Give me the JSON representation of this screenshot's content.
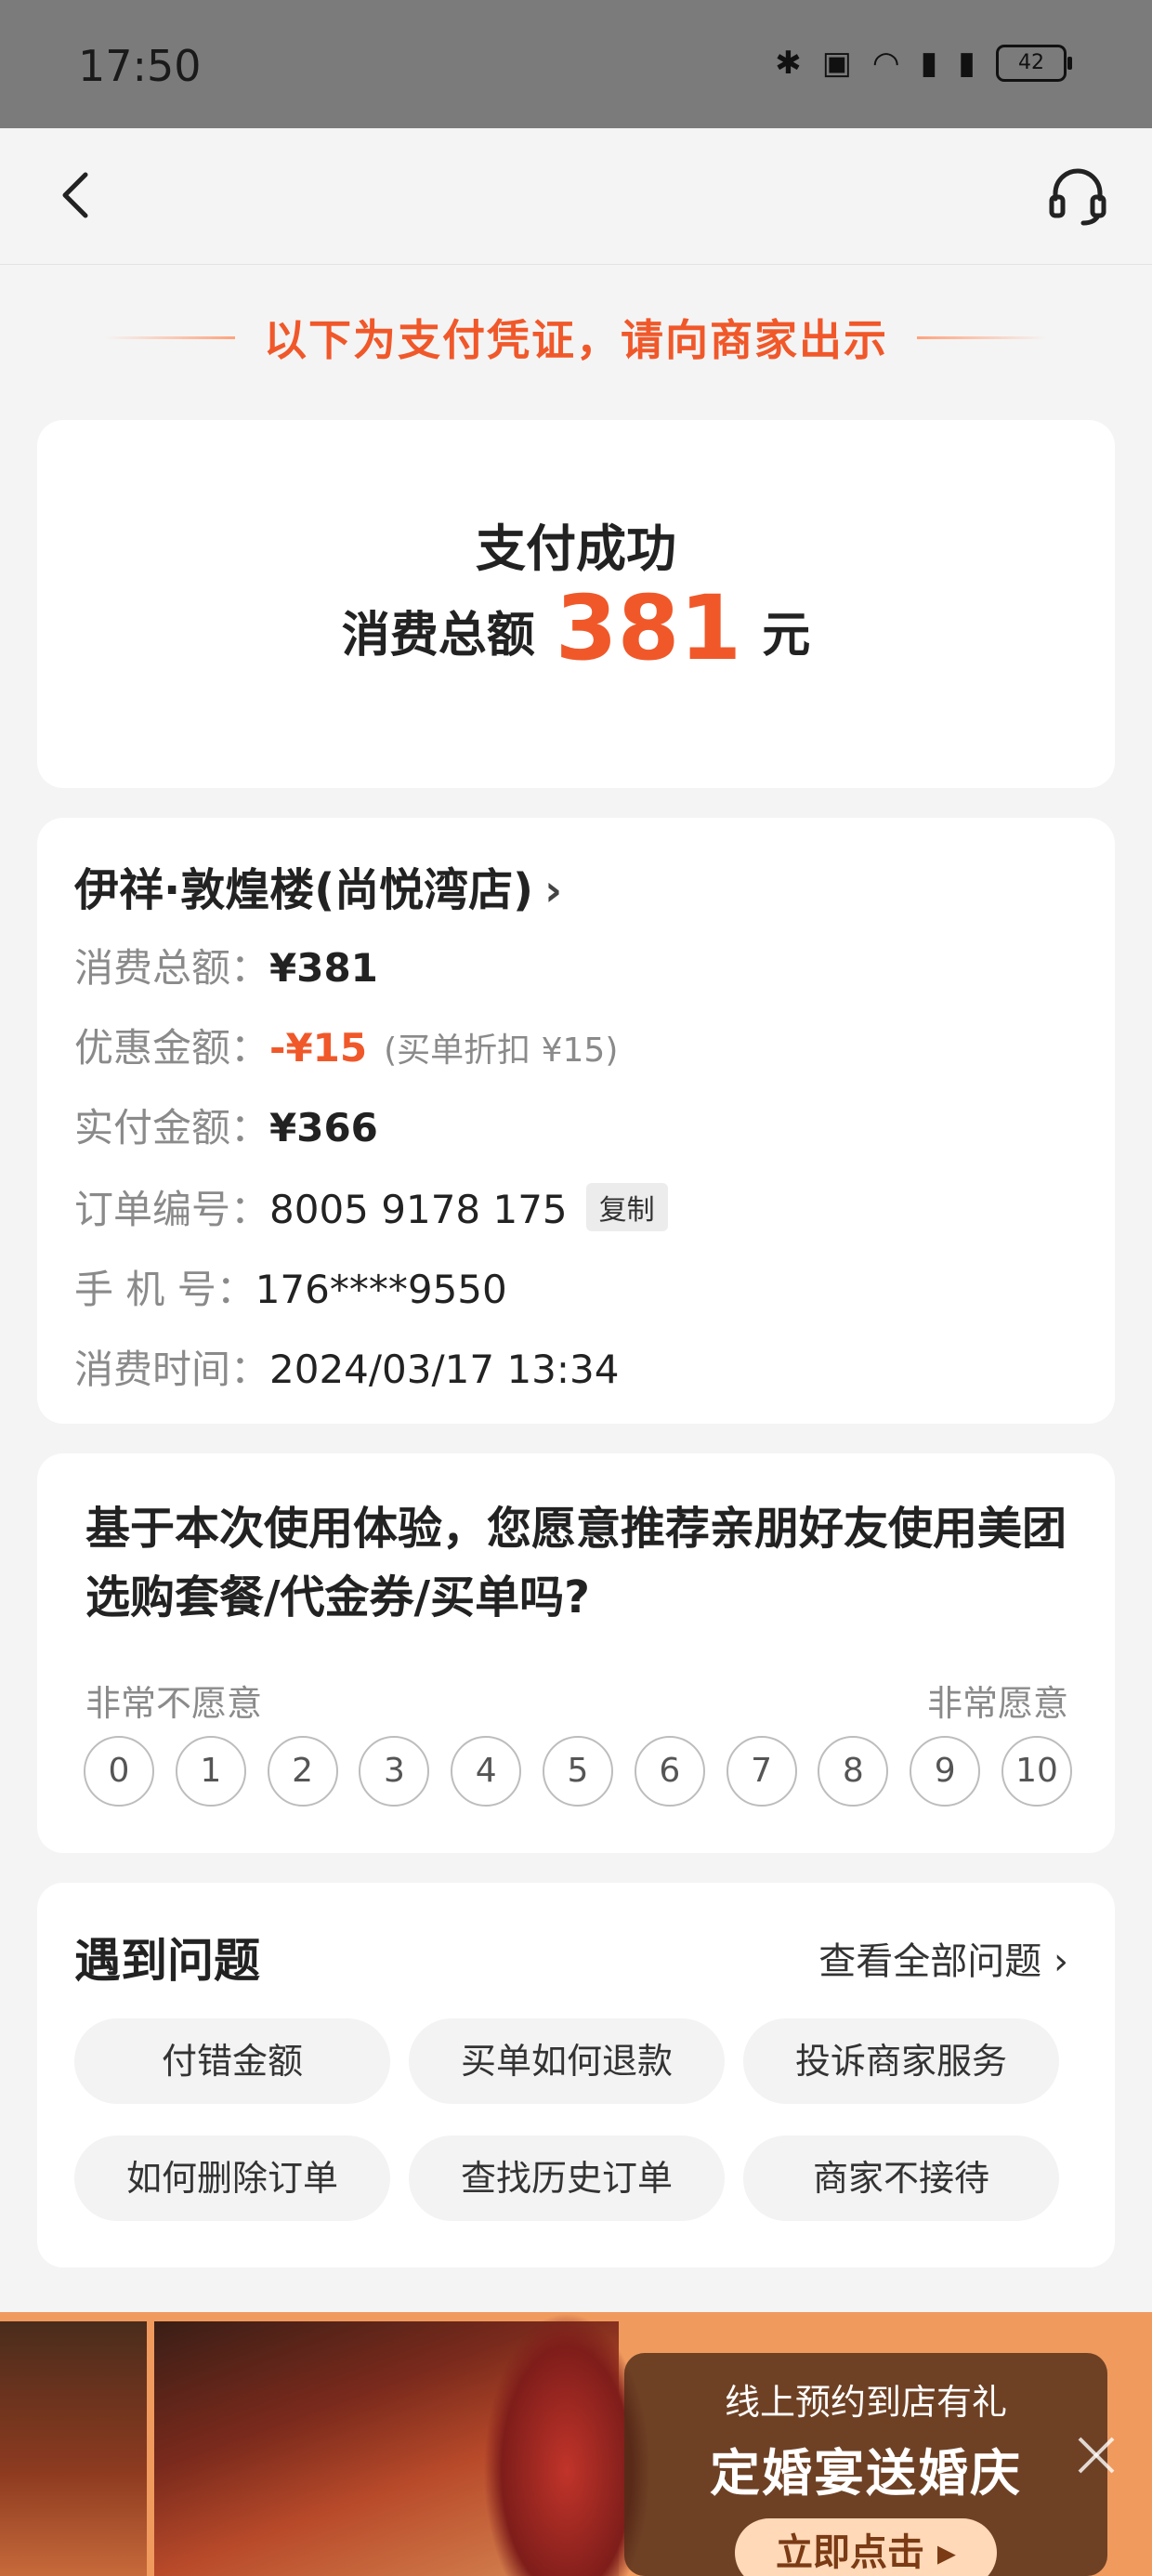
{
  "status_bar": {
    "time": "17:50",
    "battery": "42"
  },
  "banner_tip": "以下为支付凭证，请向商家出示",
  "payment": {
    "status": "支付成功",
    "total_label": "消费总额",
    "total_value": "381",
    "unit": "元"
  },
  "order": {
    "shop_name": "伊祥·敦煌楼(尚悦湾店)",
    "rows": [
      {
        "label": "消费总额：",
        "value": "¥381"
      },
      {
        "label": "优惠金额：",
        "value": "-¥15",
        "note": "(买单折扣 ¥15)"
      },
      {
        "label": "实付金额：",
        "value": "¥366"
      },
      {
        "label": "订单编号：",
        "value": "8005 9178 175",
        "action": "复制"
      },
      {
        "label": "手 机 号：",
        "value": "176****9550"
      },
      {
        "label": "消费时间：",
        "value": "2024/03/17 13:34"
      }
    ]
  },
  "survey": {
    "question": "基于本次使用体验，您愿意推荐亲朋好友使用美团选购套餐/代金券/买单吗?",
    "left_label": "非常不愿意",
    "right_label": "非常愿意",
    "scale": [
      "0",
      "1",
      "2",
      "3",
      "4",
      "5",
      "6",
      "7",
      "8",
      "9",
      "10"
    ]
  },
  "help": {
    "title": "遇到问题",
    "view_all": "查看全部问题",
    "chips": [
      "付错金额",
      "买单如何退款",
      "投诉商家服务",
      "如何删除订单",
      "查找历史订单",
      "商家不接待"
    ]
  },
  "ad": {
    "line1": "线上预约到店有礼",
    "line2": "定婚宴送婚庆",
    "button": "立即点击"
  },
  "colors": {
    "accent": "#f0582a",
    "background": "#f4f4f4"
  }
}
